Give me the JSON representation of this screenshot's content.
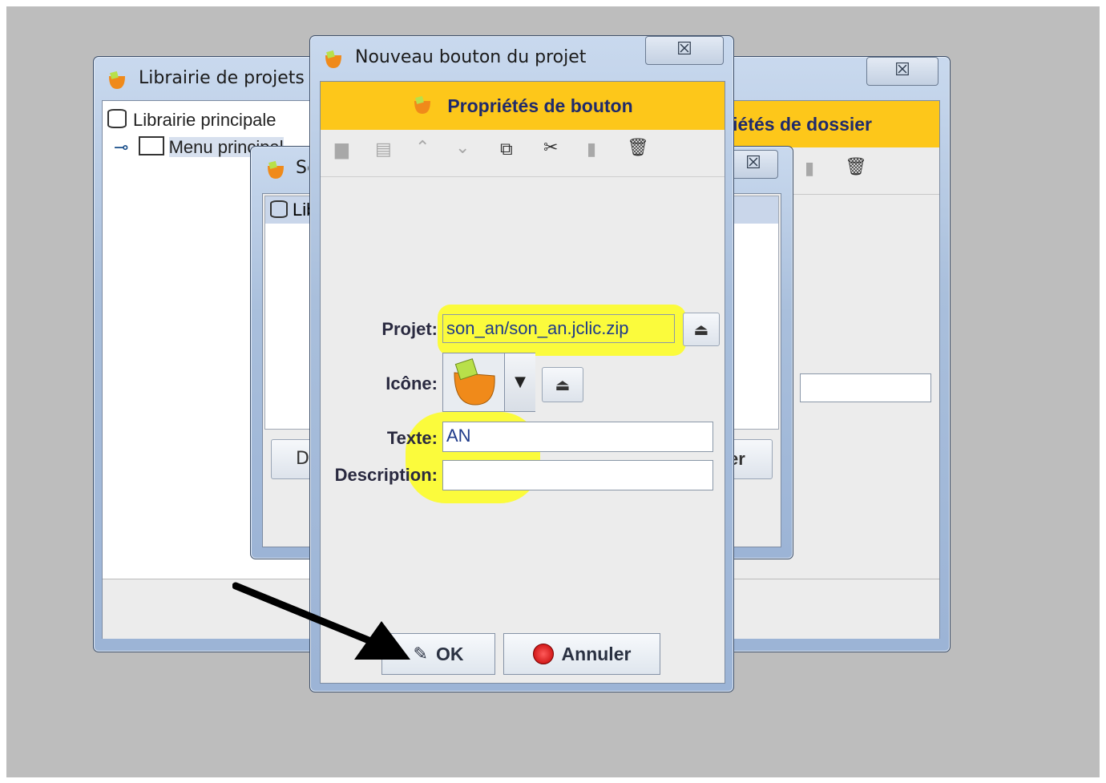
{
  "back_window": {
    "title": "Librairie de projets J",
    "close": "☒",
    "header": "Propriétés de dossier",
    "tree": [
      {
        "label": "Librairie principale"
      },
      {
        "label": "Menu principal"
      }
    ]
  },
  "middle_window": {
    "title": "Sélectionner",
    "close": "☒",
    "tree_root": "Librairie",
    "left_button": "D",
    "right_button_fragment": "er"
  },
  "front_window": {
    "title": "Nouveau bouton du projet",
    "close": "☒",
    "header": "Propriétés de bouton",
    "toolbar": [
      "new-folder",
      "open-folder",
      "move-up",
      "move-down",
      "copy",
      "cut",
      "paste",
      "delete"
    ],
    "form": {
      "projet_label": "Projet:",
      "projet_value": "son_an/son_an.jclic.zip",
      "icone_label": "Icône:",
      "texte_label": "Texte:",
      "texte_value": "AN",
      "description_label": "Description:",
      "description_value": ""
    },
    "ok_label": "OK",
    "cancel_label": "Annuler"
  },
  "colors": {
    "header_yellow": "#fdc71a",
    "highlight_yellow": "#fbfb3c",
    "desktop_gray": "#bdbdbd"
  }
}
